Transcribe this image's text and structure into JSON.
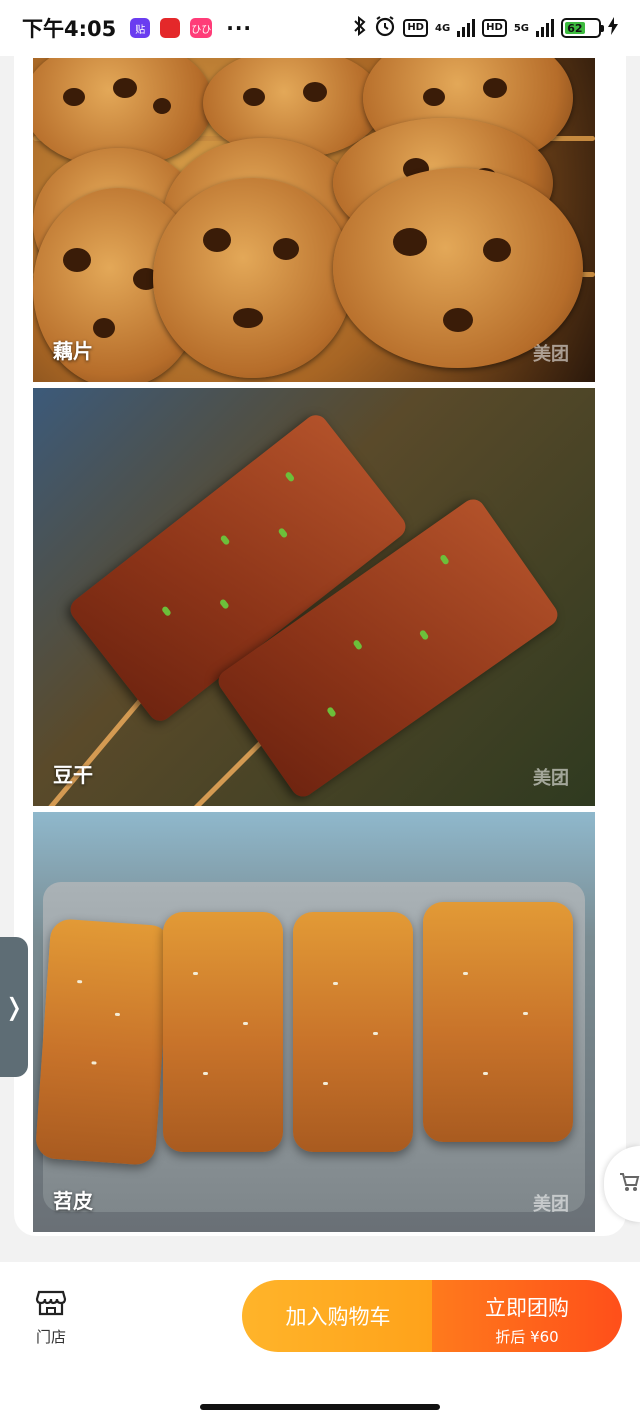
{
  "status_bar": {
    "time": "下午4:05",
    "app_badges": [
      "贴",
      "",
      "ひひ"
    ],
    "more": "···",
    "network_1": "4G",
    "network_2": "5G",
    "hd_1": "HD",
    "hd_2": "HD",
    "battery": "62"
  },
  "gallery": {
    "items": [
      {
        "label": "藕片",
        "watermark": "美团"
      },
      {
        "label": "豆干",
        "watermark": "美团"
      },
      {
        "label": "苕皮",
        "watermark": "美团"
      }
    ]
  },
  "side_tab": {
    "icon": "❭"
  },
  "cart_float": {
    "icon": "cart-icon"
  },
  "bottom_bar": {
    "store_label": "门店",
    "add_to_cart": "加入购物车",
    "buy_now": "立即团购",
    "price_after_discount": "折后 ¥60"
  },
  "colors": {
    "cart_button": "#ffa21a",
    "buy_button": "#ff5a1a"
  }
}
